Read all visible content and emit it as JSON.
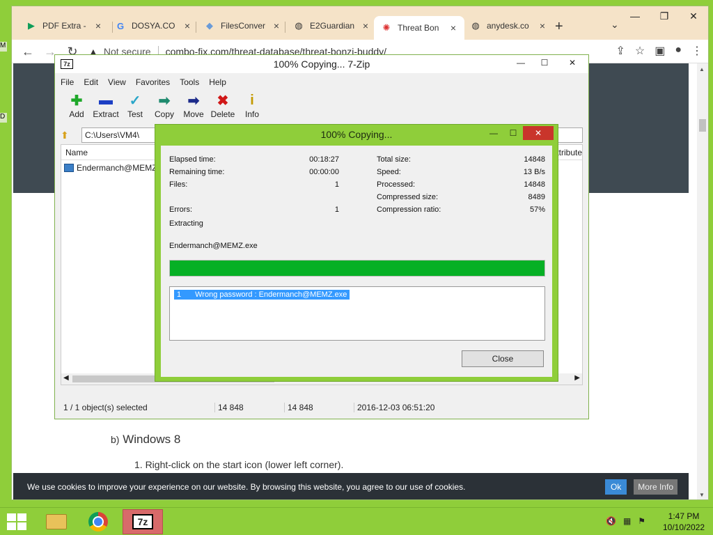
{
  "browser": {
    "tabs": [
      {
        "label": "PDF Extra -",
        "icon": "play-store-icon"
      },
      {
        "label": "DOSYA.CO",
        "icon": "google-icon"
      },
      {
        "label": "FilesConver",
        "icon": "files-icon"
      },
      {
        "label": "E2Guardian",
        "icon": "globe-icon"
      },
      {
        "label": "Threat Bon",
        "icon": "combofix-icon"
      },
      {
        "label": "anydesk.co",
        "icon": "globe-icon"
      }
    ],
    "not_secure": "Not secure",
    "url": "combo-fix.com/threat-database/threat-bonzi-buddy/"
  },
  "page": {
    "heading_prefix": "b)",
    "heading": "Windows 8",
    "list_item": "1. Right-click on the start icon (lower left corner).",
    "cookie_text": "We use cookies to improve your experience on our website. By browsing this website, you agree to our use of cookies.",
    "ok_label": "Ok",
    "more_label": "More Info"
  },
  "zip": {
    "title": "100% Copying... 7-Zip",
    "logo": "7z",
    "menu": [
      "File",
      "Edit",
      "View",
      "Favorites",
      "Tools",
      "Help"
    ],
    "tools": [
      {
        "label": "Add",
        "icon": "add-icon",
        "glyph": "✚",
        "color": "#1fa82a"
      },
      {
        "label": "Extract",
        "icon": "extract-icon",
        "glyph": "▬",
        "color": "#1c3fc4"
      },
      {
        "label": "Test",
        "icon": "test-icon",
        "glyph": "✓",
        "color": "#2aa6c9"
      },
      {
        "label": "Copy",
        "icon": "copy-icon",
        "glyph": "➡",
        "color": "#1e8a6e"
      },
      {
        "label": "Move",
        "icon": "move-icon",
        "glyph": "➡",
        "color": "#1c2a8a"
      },
      {
        "label": "Delete",
        "icon": "delete-icon",
        "glyph": "✖",
        "color": "#d01818"
      },
      {
        "label": "Info",
        "icon": "info-icon",
        "glyph": "i",
        "color": "#c49a00"
      }
    ],
    "path": "C:\\Users\\VM4\\",
    "col_name": "Name",
    "col_attr": "ttribute",
    "file": "Endermanch@MEMZ",
    "status": [
      "1 / 1 object(s) selected",
      "14 848",
      "14 848",
      "2016-12-03 06:51:20"
    ]
  },
  "dialog": {
    "title": "100% Copying...",
    "elapsed_label": "Elapsed time:",
    "elapsed": "00:18:27",
    "remaining_label": "Remaining time:",
    "remaining": "00:00:00",
    "files_label": "Files:",
    "files": "1",
    "errors_label": "Errors:",
    "errors": "1",
    "total_label": "Total size:",
    "total": "14848",
    "speed_label": "Speed:",
    "speed": "13 B/s",
    "processed_label": "Processed:",
    "processed": "14848",
    "compressed_label": "Compressed size:",
    "compressed": "8489",
    "ratio_label": "Compression ratio:",
    "ratio": "57%",
    "operation": "Extracting",
    "filename": "Endermanch@MEMZ.exe",
    "progress": 1.0,
    "log_num": "1",
    "log_text": "Wrong password : Endermanch@MEMZ.exe",
    "close_label": "Close"
  },
  "taskbar": {
    "time": "1:47 PM",
    "date": "10/10/2022"
  }
}
